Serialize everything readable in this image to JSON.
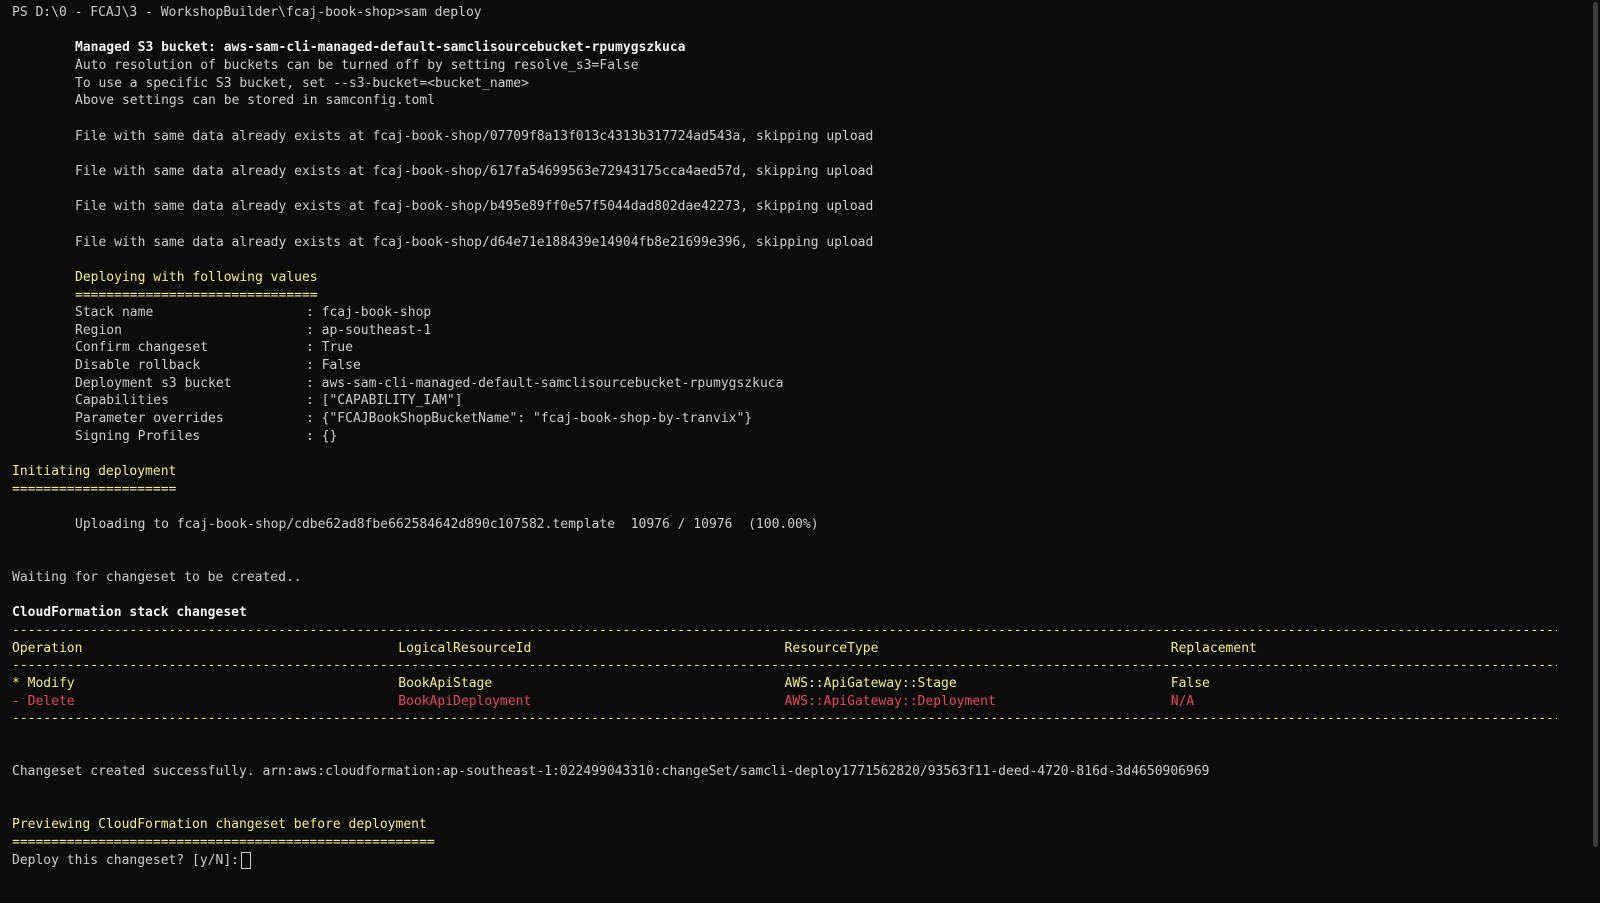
{
  "prompt": {
    "path": "PS D:\\0 - FCAJ\\3 - WorkshopBuilder\\fcaj-book-shop>",
    "command": "sam deploy"
  },
  "bucket_info": {
    "managed_line": "Managed S3 bucket: aws-sam-cli-managed-default-samclisourcebucket-rpumygszkuca",
    "auto_line": "Auto resolution of buckets can be turned off by setting resolve_s3=False",
    "specific_line": "To use a specific S3 bucket, set --s3-bucket=<bucket_name>",
    "stored_line": "Above settings can be stored in samconfig.toml"
  },
  "skipped_uploads": [
    "File with same data already exists at fcaj-book-shop/07709f8a13f013c4313b317724ad543a, skipping upload",
    "File with same data already exists at fcaj-book-shop/617fa54699563e72943175cca4aed57d, skipping upload",
    "File with same data already exists at fcaj-book-shop/b495e89ff0e57f5044dad802dae42273, skipping upload",
    "File with same data already exists at fcaj-book-shop/d64e71e188439e14904fb8e21699e396, skipping upload"
  ],
  "deploy_values": {
    "heading": "Deploying with following values",
    "underline": "===============================",
    "items": [
      {
        "key": "Stack name",
        "value": ": fcaj-book-shop"
      },
      {
        "key": "Region",
        "value": ": ap-southeast-1"
      },
      {
        "key": "Confirm changeset",
        "value": ": True"
      },
      {
        "key": "Disable rollback",
        "value": ": False"
      },
      {
        "key": "Deployment s3 bucket",
        "value": ": aws-sam-cli-managed-default-samclisourcebucket-rpumygszkuca"
      },
      {
        "key": "Capabilities",
        "value": ": [\"CAPABILITY_IAM\"]"
      },
      {
        "key": "Parameter overrides",
        "value": ": {\"FCAJBookShopBucketName\": \"fcaj-book-shop-by-tranvix\"}"
      },
      {
        "key": "Signing Profiles",
        "value": ": {}"
      }
    ]
  },
  "initiating": {
    "heading": "Initiating deployment",
    "underline": "====================="
  },
  "upload_line": "Uploading to fcaj-book-shop/cdbe62ad8fbe662584642d890c107582.template  10976 / 10976  (100.00%)",
  "waiting_line": "Waiting for changeset to be created..",
  "changeset": {
    "title": "CloudFormation stack changeset",
    "separator": "---------------------------------------------------------------------------------------------------------------------------------------------------------------------------------------------------------------",
    "headers": [
      "Operation",
      "LogicalResourceId",
      "ResourceType",
      "Replacement"
    ],
    "rows": [
      {
        "cells": [
          "* Modify",
          "BookApiStage",
          "AWS::ApiGateway::Stage",
          "False"
        ],
        "color": "#f0f07a"
      },
      {
        "cells": [
          "- Delete",
          "BookApiDeployment",
          "AWS::ApiGateway::Deployment",
          "N/A"
        ],
        "color": "#e74856"
      }
    ]
  },
  "created_line": "Changeset created successfully. arn:aws:cloudformation:ap-southeast-1:022499043310:changeSet/samcli-deploy1771562820/93563f11-deed-4720-816d-3d4650906969",
  "preview": {
    "heading": "Previewing CloudFormation changeset before deployment",
    "underline": "======================================================"
  },
  "confirm_prompt": "Deploy this changeset? [y/N]:"
}
